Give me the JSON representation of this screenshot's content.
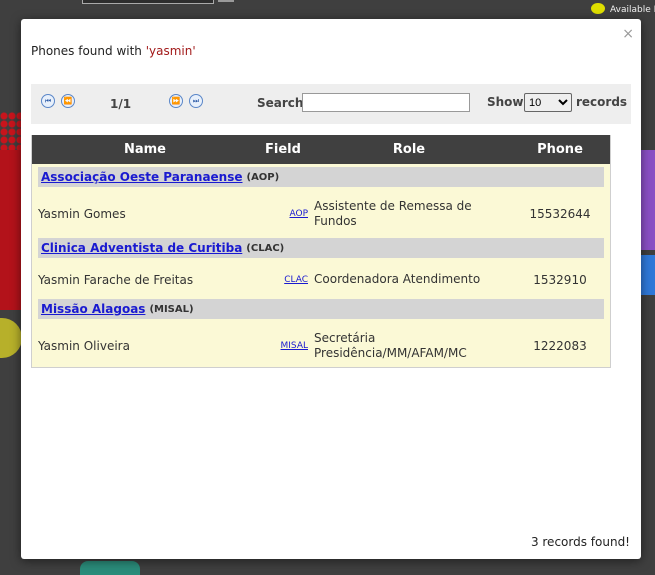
{
  "background": {
    "legend_label": "Available D"
  },
  "modal": {
    "close_symbol": "×",
    "title_prefix": "Phones found with ",
    "query_display": "'yasmin'"
  },
  "toolbar": {
    "page_info": "1/1",
    "search_label": "Search",
    "search_value": "",
    "show_label": "Show",
    "show_value": "10",
    "show_options": [
      "10"
    ],
    "records_label": "records",
    "nav_icons": [
      "first-page-icon",
      "previous-page-icon",
      "next-page-icon",
      "last-page-icon"
    ]
  },
  "table": {
    "headers": {
      "name": "Name",
      "field": "Field",
      "role": "Role",
      "phone": "Phone"
    },
    "groups": [
      {
        "name": "Associação Oeste Paranaense",
        "code": "(AOP)",
        "rows": [
          {
            "name": "Yasmin Gomes",
            "field": "AOP",
            "role": "Assistente de Remessa de Fundos",
            "phone": "15532644"
          }
        ]
      },
      {
        "name": "Clinica Adventista de Curitiba",
        "code": "(CLAC)",
        "rows": [
          {
            "name": "Yasmin Farache de Freitas",
            "field": "CLAC",
            "role": "Coordenadora Atendimento",
            "phone": "1532910"
          }
        ]
      },
      {
        "name": "Missão Alagoas",
        "code": "(MISAL)",
        "rows": [
          {
            "name": "Yasmin Oliveira",
            "field": "MISAL",
            "role": "Secretária Presidência/MM/AFAM/MC",
            "phone": "1222083"
          }
        ]
      }
    ]
  },
  "footer": {
    "count_text": "3 records found!"
  },
  "colors": {
    "header_bg": "#404040",
    "row_bg": "#fbf9d6",
    "group_bg": "#d4d4d4",
    "link": "#1a1ad0",
    "query": "#a21a1a"
  }
}
